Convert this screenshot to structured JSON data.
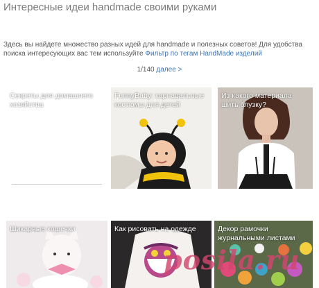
{
  "page": {
    "title": "Интересные идеи handmade своими руками",
    "intro_text": "Здесь вы найдете множество разных идей для handmade и полезных советов! Для удобства поиска интересующих вас тем используйте",
    "intro_link": "Фильтр по тегам HandMade изделий",
    "pager_count": "1/140",
    "pager_next": "далее >"
  },
  "cards": [
    {
      "caption": "Секреты для домашнего хозяйства"
    },
    {
      "caption": "FunnyBaby: карнавальные костюмы для детей"
    },
    {
      "caption": "Из какого материала шить блузку?"
    },
    {
      "caption": "Шикарные кошечки"
    },
    {
      "caption": "Как рисовать на одежде"
    },
    {
      "caption": "Декор рамочки журнальными листами"
    }
  ],
  "watermark": "posila.ru",
  "colors": {
    "link": "#3a73b5",
    "watermark": "#d2466e"
  }
}
